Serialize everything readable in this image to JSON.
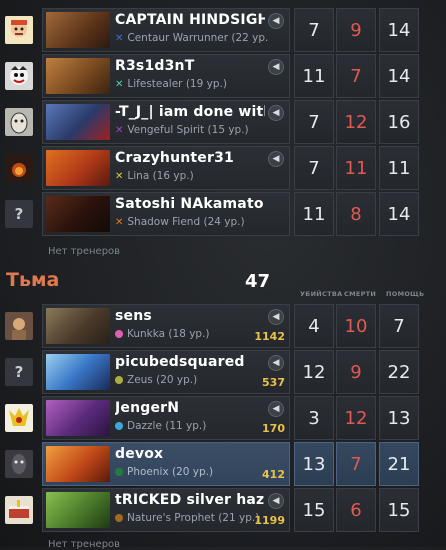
{
  "top_team": {
    "players": [
      {
        "name": "CAPTAIN HINDSIGHT",
        "hero": "Centaur Warrunner (22 ур.",
        "hero_color": "#3f6fd6",
        "kills": "7",
        "deaths": "9",
        "assists": "14",
        "avatar": "face-avatar",
        "portrait": "#7a4a2a"
      },
      {
        "name": "R3s1d3nT",
        "hero": "Lifestealer (19 ур.)",
        "hero_color": "#4ad2a4",
        "kills": "11",
        "deaths": "7",
        "assists": "14",
        "avatar": "joker-avatar",
        "portrait": "#8a5a2e"
      },
      {
        "name": "-T_J_| iam done with t",
        "hero": "Vengeful Spirit (15 ур.)",
        "hero_color": "#a040c8",
        "kills": "7",
        "deaths": "12",
        "assists": "16",
        "avatar": "sketch-avatar",
        "portrait": "#4a5a8a"
      },
      {
        "name": "Crazyhunter31",
        "hero": "Lina (16 ур.)",
        "hero_color": "#d8d040",
        "kills": "7",
        "deaths": "11",
        "assists": "11",
        "avatar": "fire-avatar",
        "portrait": "#b04820"
      },
      {
        "name": "Satoshi NAkamato",
        "hero": "Shadow Fiend (24 ур.)",
        "hero_color": "#e07c1e",
        "kills": "11",
        "deaths": "8",
        "assists": "14",
        "avatar": "unknown-avatar",
        "portrait": "#3a1a12"
      }
    ],
    "no_coaches": "Нет тренеров"
  },
  "bottom_team": {
    "name": "Тьма",
    "score": "47",
    "col_kills": "УБИЙСТВА",
    "col_deaths": "СМЕРТИ",
    "col_assists": "ПОМОЩЬ",
    "players": [
      {
        "name": "sens",
        "hero": "Kunkka (18 ур.)",
        "hero_color": "#e060b0",
        "gold": "1142",
        "kills": "4",
        "deaths": "10",
        "assists": "7",
        "avatar": "warrior-avatar",
        "portrait": "#6a5a4a"
      },
      {
        "name": "picubedsquared",
        "hero": "Zeus (20 ур.)",
        "hero_color": "#a8b040",
        "gold": "537",
        "kills": "12",
        "deaths": "9",
        "assists": "22",
        "avatar": "unknown-avatar",
        "portrait": "#3a70c0"
      },
      {
        "name": "JengerN",
        "hero": "Dazzle (11 ур.)",
        "hero_color": "#40a8d8",
        "gold": "170",
        "kills": "3",
        "deaths": "12",
        "assists": "13",
        "avatar": "cartoon-avatar",
        "portrait": "#6a3a8a"
      },
      {
        "name": "devox",
        "hero": "Phoenix (20 ур.)",
        "hero_color": "#208040",
        "gold": "412",
        "kills": "13",
        "deaths": "7",
        "assists": "21",
        "avatar": "dark-avatar",
        "portrait": "#c05018",
        "self": true
      },
      {
        "name": "tRICKED silver haze",
        "hero": "Nature's Prophet (21 ур.)",
        "hero_color": "#a06a20",
        "gold": "1199",
        "kills": "15",
        "deaths": "6",
        "assists": "15",
        "avatar": "cake-avatar",
        "portrait": "#4a7a3a"
      }
    ],
    "no_coaches": "Нет тренеров"
  },
  "icons": {
    "voice": "speaker-icon",
    "unknown": "?"
  }
}
